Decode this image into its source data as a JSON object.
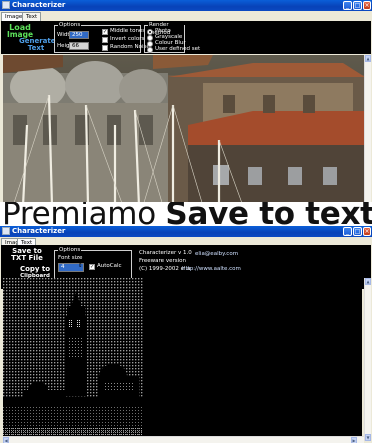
{
  "window1": {
    "title": "Characterizer",
    "tabs": [
      "Image",
      "Text"
    ],
    "load_button": {
      "line1": "Load",
      "line2": "Image"
    },
    "generate_button": {
      "line1": "Generate",
      "line2": "Text"
    },
    "options": {
      "label": "Options",
      "width_label": "Width",
      "width_value": "250",
      "height_label": "Height",
      "height_value": "66",
      "checks": [
        {
          "label": "Middle tones",
          "checked": true
        },
        {
          "label": "Invert colors",
          "checked": false
        },
        {
          "label": "Random Noise",
          "checked": false
        }
      ]
    },
    "render": {
      "label": "Render method",
      "options": [
        {
          "label": "Photo",
          "selected": true
        },
        {
          "label": "Grayscale",
          "selected": false
        },
        {
          "label": "Colour Blur",
          "selected": false
        },
        {
          "label": "User defined set",
          "selected": false
        }
      ]
    }
  },
  "overlay": {
    "text1": "Premiamo ",
    "text2": "Save to text file"
  },
  "window2": {
    "title": "Characterizer",
    "tabs": [
      "Image",
      "Text"
    ],
    "save_button": {
      "line1": "Save to",
      "line2": "TXT File"
    },
    "copy_button": {
      "line1": "Copy to",
      "line2": "Clipboard"
    },
    "options": {
      "label": "Options",
      "font_size_label": "Font size",
      "font_size_value": "4",
      "autocalc_label": "AutoCalc",
      "autocalc_checked": true
    },
    "about": {
      "version": "Characterizer v 1.0",
      "freeware": "Freeware version",
      "copyright": "(C)   1999-2002  elia",
      "email": "elia@ealby.com",
      "url": "http://www.aalte.com"
    }
  },
  "colors": {
    "load_green": "#5ce05a",
    "generate_blue": "#4f9fe8",
    "titlebar_blue": "#0842b8",
    "ascii_grey": "#bdbdbd"
  }
}
